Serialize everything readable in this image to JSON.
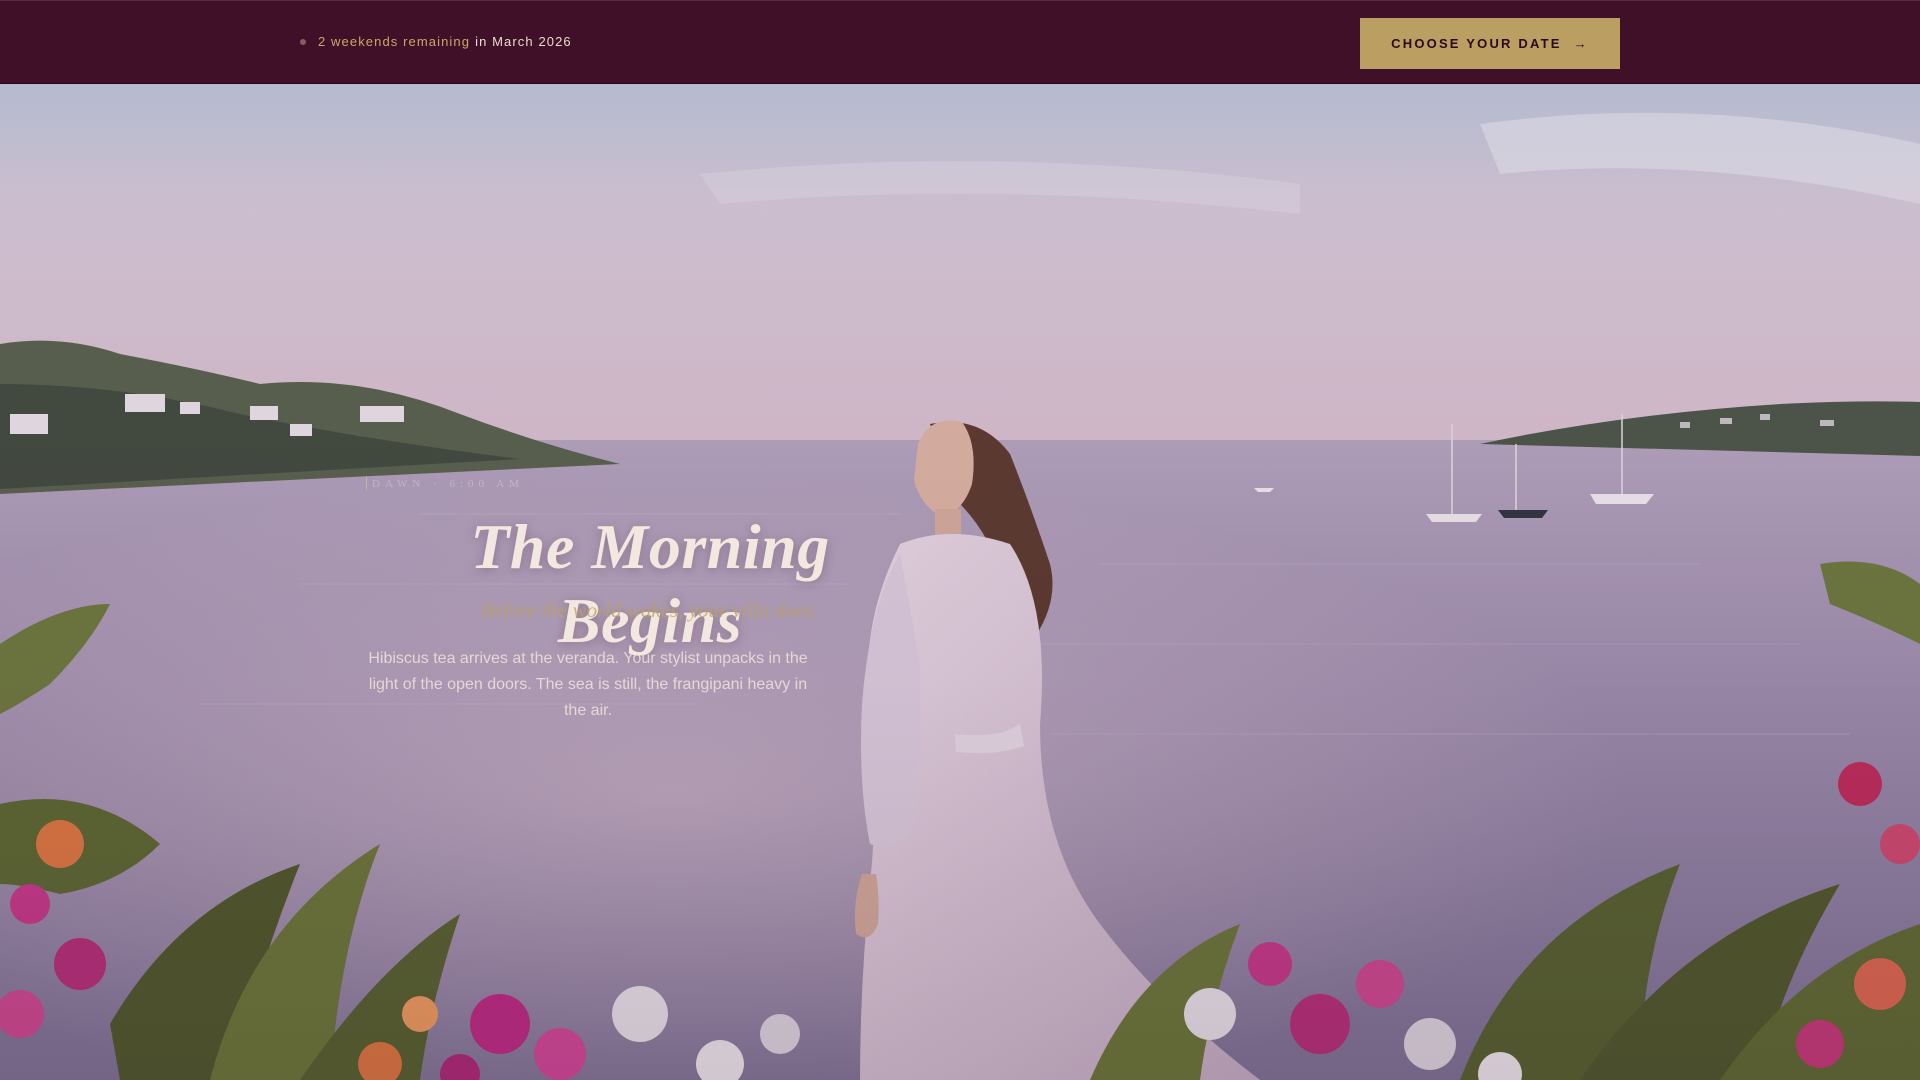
{
  "announcement": {
    "highlight": "2 weekends remaining",
    "rest": "in March 2026"
  },
  "cta": {
    "label": "CHOOSE YOUR DATE",
    "arrow": "→"
  },
  "hero": {
    "eyebrow": "DAWN · 6:00 AM",
    "title": "The Morning Begins",
    "subtitle": "Before the world wakes, your villa does.",
    "body": "Hibiscus tea arrives at the veranda. Your stylist unpacks in the light of the open doors. The sea is still, the frangipani heavy in the air."
  },
  "colors": {
    "bar_background": "#3f1027",
    "cta_gold": "#bb9f62",
    "highlight_gold": "#c9a86a",
    "headline_cream": "#f3e8df"
  },
  "icons": [
    "status-dot-icon",
    "arrow-right-icon"
  ]
}
